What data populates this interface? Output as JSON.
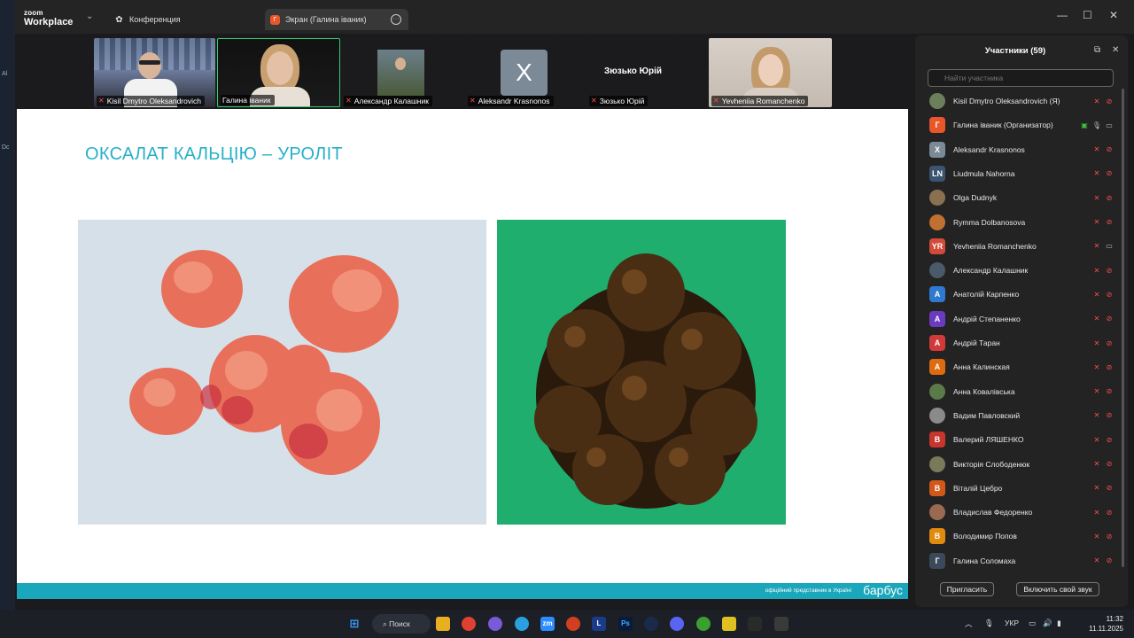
{
  "app": {
    "logo_line1": "zoom",
    "logo_line2": "Workplace",
    "tab_conference": "Конференция",
    "tab_screen": "Экран (Галина іваник)",
    "screen_tab_initial": "Г"
  },
  "desktop_strip": [
    "Al",
    "Dc"
  ],
  "video_tiles": [
    {
      "name": "Kisil Dmytro Oleksandrovich",
      "muted": true
    },
    {
      "name": "Галина іваник",
      "muted": false
    },
    {
      "name": "Александр Калашник",
      "muted": true
    },
    {
      "name": "Aleksandr Krasnonos",
      "muted": true,
      "initial": "X"
    },
    {
      "name": "Зюзько Юрій",
      "muted": true,
      "big_label": "Зюзько Юрій"
    },
    {
      "name": "Yevheniia Romanchenko",
      "muted": true
    }
  ],
  "slide": {
    "title": "ОКСАЛАТ КАЛЬЦІЮ – УРОЛІТ",
    "footer_sub": "офіційний представник в Україні",
    "footer_brand": "барбус"
  },
  "panel": {
    "title": "Участники (59)",
    "search_placeholder": "Найти участника",
    "invite_label": "Пригласить",
    "unmute_label": "Включить свой звук",
    "participants": [
      {
        "name": "Kisil Dmytro Oleksandrovich (Я)",
        "initial": "",
        "color": "#6a7f5a",
        "photo": true,
        "mic": "off",
        "cam": "off"
      },
      {
        "name": "Галина іваник (Организатор)",
        "initial": "Г",
        "color": "#e8562a",
        "photo": false,
        "mic": "on",
        "cam": "on"
      },
      {
        "name": "Aleksandr Krasnonos",
        "initial": "X",
        "color": "#7b8a96",
        "photo": false,
        "mic": "off",
        "cam": "off"
      },
      {
        "name": "Liudmula Nahorna",
        "initial": "LN",
        "color": "#3c5470",
        "photo": false,
        "mic": "off",
        "cam": "off"
      },
      {
        "name": "Olga Dudnyk",
        "initial": "",
        "color": "#8a7050",
        "photo": true,
        "mic": "off",
        "cam": "off"
      },
      {
        "name": "Rymma Dolbanosova",
        "initial": "",
        "color": "#c07030",
        "photo": true,
        "mic": "off",
        "cam": "off"
      },
      {
        "name": "Yevheniia Romanchenko",
        "initial": "YR",
        "color": "#d24a3a",
        "photo": false,
        "mic": "off",
        "cam": "on"
      },
      {
        "name": "Александр Калашник",
        "initial": "",
        "color": "#4a5a6a",
        "photo": true,
        "mic": "off",
        "cam": "off"
      },
      {
        "name": "Анатолій Карпенко",
        "initial": "А",
        "color": "#2f7ad0",
        "photo": false,
        "mic": "off",
        "cam": "off"
      },
      {
        "name": "Андрій Степаненко",
        "initial": "А",
        "color": "#6a3ac0",
        "photo": false,
        "mic": "off",
        "cam": "off"
      },
      {
        "name": "Андрій Таран",
        "initial": "А",
        "color": "#d23a3a",
        "photo": false,
        "mic": "off",
        "cam": "off"
      },
      {
        "name": "Анна Калинская",
        "initial": "А",
        "color": "#e06a10",
        "photo": false,
        "mic": "off",
        "cam": "off"
      },
      {
        "name": "Анна Ковалівська",
        "initial": "",
        "color": "#5a7a4a",
        "photo": true,
        "mic": "off",
        "cam": "off"
      },
      {
        "name": "Вадим Павловский",
        "initial": "",
        "color": "#8a8a8a",
        "photo": true,
        "mic": "off",
        "cam": "off"
      },
      {
        "name": "Валерий ЛЯШЕНКО",
        "initial": "В",
        "color": "#c8352e",
        "photo": false,
        "mic": "off",
        "cam": "off"
      },
      {
        "name": "Викторія Слободенюк",
        "initial": "",
        "color": "#7a7a5a",
        "photo": true,
        "mic": "off",
        "cam": "off"
      },
      {
        "name": "Віталій Цебро",
        "initial": "В",
        "color": "#d0581a",
        "photo": false,
        "mic": "off",
        "cam": "off"
      },
      {
        "name": "Владислав Федоренко",
        "initial": "",
        "color": "#9a6a50",
        "photo": true,
        "mic": "off",
        "cam": "off"
      },
      {
        "name": "Володимир Попов",
        "initial": "В",
        "color": "#e08a10",
        "photo": false,
        "mic": "off",
        "cam": "off"
      },
      {
        "name": "Галина Соломаха",
        "initial": "Г",
        "color": "#3a4a5a",
        "photo": false,
        "mic": "off",
        "cam": "off"
      }
    ]
  },
  "taskbar": {
    "search_label": "Поиск",
    "lang": "УКР",
    "time": "11:32",
    "date": "11.11.2025"
  },
  "colors": {
    "slide_title": "#27b0c8",
    "slide_footer": "#1aa6bb",
    "active_speaker_border": "#2ecc71",
    "mic_off": "#ff4d4d"
  }
}
